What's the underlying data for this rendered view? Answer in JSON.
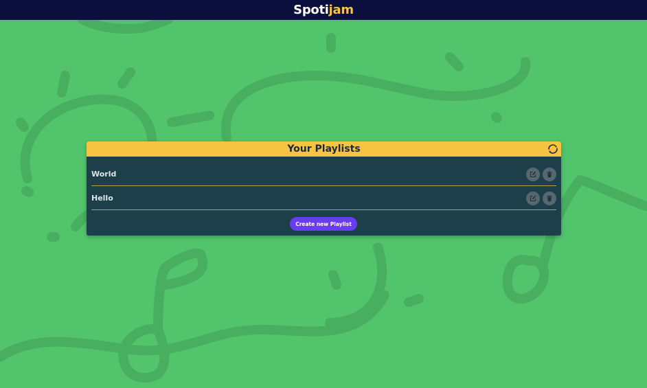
{
  "navbar": {
    "logo_part1": "Spoti",
    "logo_part2": "jam"
  },
  "card": {
    "title": "Your Playlists",
    "refresh_icon": "refresh-icon"
  },
  "playlists": [
    {
      "name": "World",
      "edit_icon": "edit-icon",
      "delete_icon": "trash-icon"
    },
    {
      "name": "Hello",
      "edit_icon": "edit-icon",
      "delete_icon": "trash-icon"
    }
  ],
  "actions": {
    "create_label": "Create new Playlist"
  },
  "colors": {
    "background": "#52c46b",
    "navbar": "#0a0f3e",
    "accent_yellow": "#f6c342",
    "card": "#1d3f4a",
    "button_purple": "#6a3cf0"
  }
}
